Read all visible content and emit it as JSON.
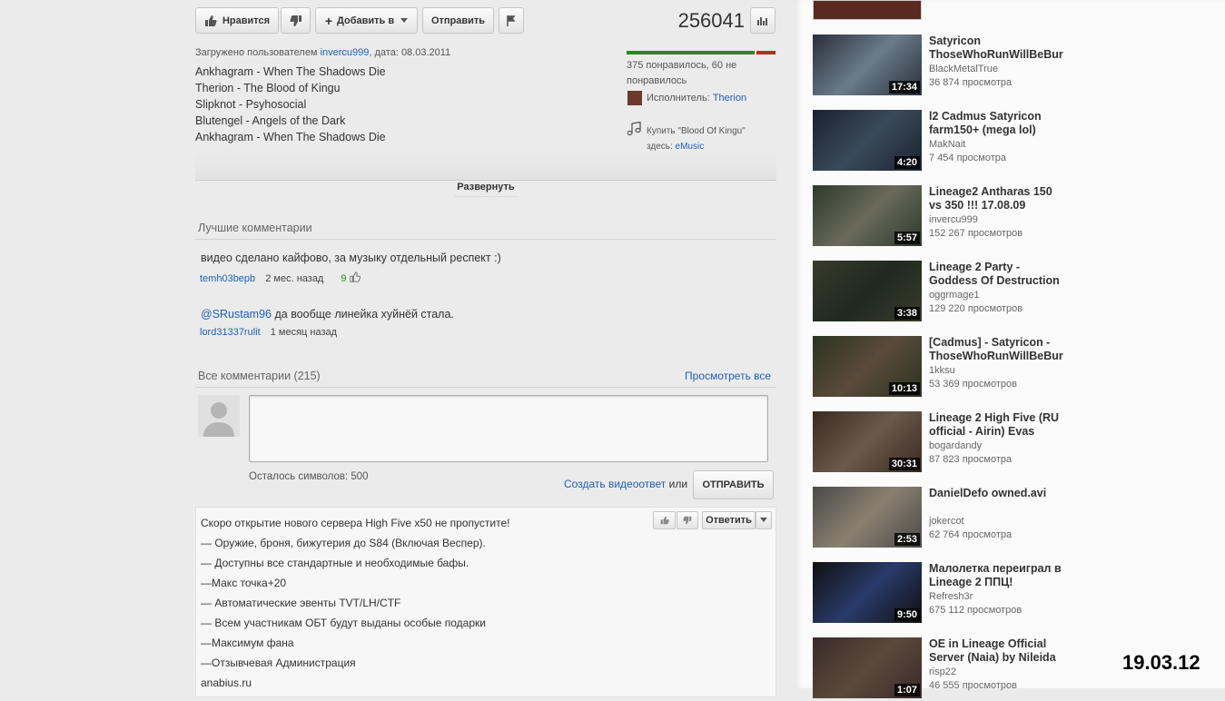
{
  "actions": {
    "like_label": "Нравится",
    "add_label": "Добавить в",
    "share_label": "Отправить",
    "view_count": "256041"
  },
  "upload": {
    "prefix": "Загружено пользователем ",
    "user": "invercu999",
    "date_text": ", дата: 08.03.2011"
  },
  "description": [
    "Ankhagram - When The Shadows Die",
    "Therion - The Blood of Kingu",
    "Slipknot - Psyhosocial",
    "Blutengel - Angels of the Dark",
    "Ankhagram - When The Shadows Die"
  ],
  "rating": {
    "text": "375 понравилось, 60 не понравилось",
    "like_fraction": 0.862
  },
  "music": {
    "artist_label": "Исполнитель: ",
    "artist": "Therion",
    "buy_line1": "Купить \"Blood Of Kingu\"",
    "buy_line2_prefix": "здесь: ",
    "buy_store": "eMusic"
  },
  "expand_label": "Развернуть",
  "top_comments": {
    "heading": "Лучшие комментарии",
    "items": [
      {
        "text": "видео сделано кайфово, за музыку отдельный респект :)",
        "user": "temh03bepb",
        "time": "2 мес. назад",
        "likes": "9"
      },
      {
        "mention": "@SRustam96",
        "text": " да вообще линейка хуйнёй стала.",
        "user": "lord31337rulit",
        "time": "1 месяц назад"
      }
    ]
  },
  "all_comments": {
    "heading": "Все комментарии (215)",
    "view_all": "Просмотреть все",
    "chars_left": "Осталось символов: 500",
    "video_reply": "Создать видеоответ",
    "or": " или",
    "send_label": "ОТПРАВИТЬ",
    "reply_label": "Ответить"
  },
  "promo_comment": [
    "Скоро открытие нового сервера High Five x50 не пропустите!",
    "— Оружие, броня, бижутерия до S84 (Включая Веспер).",
    "— Доступны все стандартные и необходимые бафы.",
    "—Макс точка+20",
    "— Автоматические эвенты TVT/LH/CTF",
    "— Всем участникам ОБТ будут выданы особые подарки",
    "—Максимум фана",
    "—Отзывчевая Администрация",
    "anabius.ru"
  ],
  "related": [
    {
      "title1": "Satyricon",
      "title2": "ThoseWhoRunWillBeBur",
      "author": "BlackMetalTrue",
      "views": "36 874 просмотра",
      "duration": "17:34"
    },
    {
      "title1": "l2 Cadmus Satyricon",
      "title2": "farm150+ (mega lol)",
      "author": "MakNait",
      "views": "7 454 просмотра",
      "duration": "4:20"
    },
    {
      "title1": "Lineage2 Antharas 150",
      "title2": "vs 350 !!! 17.08.09",
      "author": "invercu999",
      "views": "152 267 просмотров",
      "duration": "5:57"
    },
    {
      "title1": "Lineage 2 Party -",
      "title2": "Goddess Of Destruction",
      "author": "oggrmage1",
      "views": "129 220 просмотров",
      "duration": "3:38"
    },
    {
      "title1": "[Cadmus] - Satyricon -",
      "title2": "ThoseWhoRunWillBeBur",
      "author": "1kksu",
      "views": "53 369 просмотров",
      "duration": "10:13"
    },
    {
      "title1": "Lineage 2 High Five (RU",
      "title2": "official - Airin) Evas",
      "author": "bogardandy",
      "views": "87 823 просмотра",
      "duration": "30:31"
    },
    {
      "title1": "DanielDefo owned.avi",
      "title2": "",
      "author": "jokercot",
      "views": "62 764 просмотра",
      "duration": "2:53"
    },
    {
      "title1": "Малолетка переиграл в",
      "title2": "Lineage 2 ППЦ!",
      "author": "Refresh3r",
      "views": "675 112 просмотров",
      "duration": "9:50"
    },
    {
      "title1": "OE in Lineage Official",
      "title2": "Server (Naia) by Nileida",
      "author": "risp22",
      "views": "46 555 просмотров",
      "duration": "1:07"
    }
  ],
  "date_stamp": "19.03.12",
  "colors": {
    "link": "#1c62b9",
    "like_bar": "#2a8a1c",
    "dislike_bar": "#cc2222"
  }
}
